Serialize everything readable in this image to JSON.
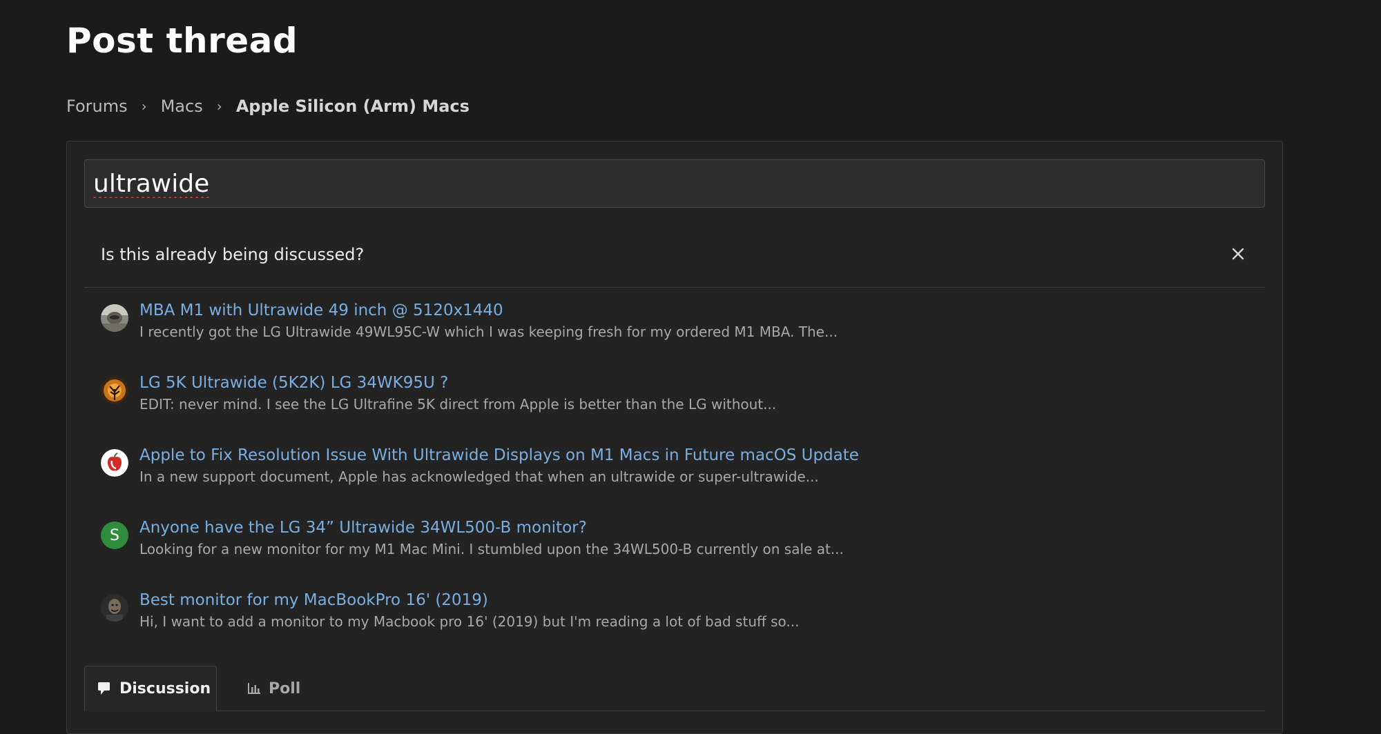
{
  "page": {
    "title": "Post thread"
  },
  "breadcrumb": {
    "items": [
      {
        "label": "Forums"
      },
      {
        "label": "Macs"
      },
      {
        "label": "Apple Silicon (Arm) Macs"
      }
    ]
  },
  "form": {
    "title_value": "ultrawide"
  },
  "similar": {
    "question": "Is this already being discussed?",
    "results": [
      {
        "title": "MBA M1 with Ultrawide 49 inch @ 5120x1440",
        "snippet": "I recently got the LG Ultrawide 49WL95C-W which I was keeping fresh for my ordered M1 MBA. The...",
        "avatar": "photo-avatar"
      },
      {
        "title": "LG 5K Ultrawide (5K2K) LG 34WK95U ?",
        "snippet": "EDIT: never mind. I see the LG Ultrafine 5K direct from Apple is better than the LG without...",
        "avatar": "tree-avatar"
      },
      {
        "title": "Apple to Fix Resolution Issue With Ultrawide Displays on M1 Macs in Future macOS Update",
        "snippet": "In a new support document, Apple has acknowledged that when an ultrawide or super-ultrawide...",
        "avatar": "apple-logo-avatar"
      },
      {
        "title": "Anyone have the LG 34” Ultrawide 34WL500-B monitor?",
        "snippet": "Looking for a new monitor for my M1 Mac Mini. I stumbled upon the 34WL500-B currently on sale at...",
        "avatar": "letter-avatar",
        "avatar_letter": "S",
        "avatar_color": "#2e8c3c"
      },
      {
        "title": "Best monitor for my MacBookPro 16' (2019)",
        "snippet": "Hi, I want to add a monitor to my Macbook pro 16' (2019) but I'm reading a lot of bad stuff so...",
        "avatar": "photo-avatar"
      }
    ]
  },
  "tabs": [
    {
      "label": "Discussion",
      "icon": "speech-bubble-icon",
      "active": true
    },
    {
      "label": "Poll",
      "icon": "bar-chart-icon",
      "active": false
    }
  ],
  "colors": {
    "background": "#1b1b1b",
    "panel": "#232323",
    "link": "#7aaee0",
    "snippet": "#a8a8a8"
  }
}
